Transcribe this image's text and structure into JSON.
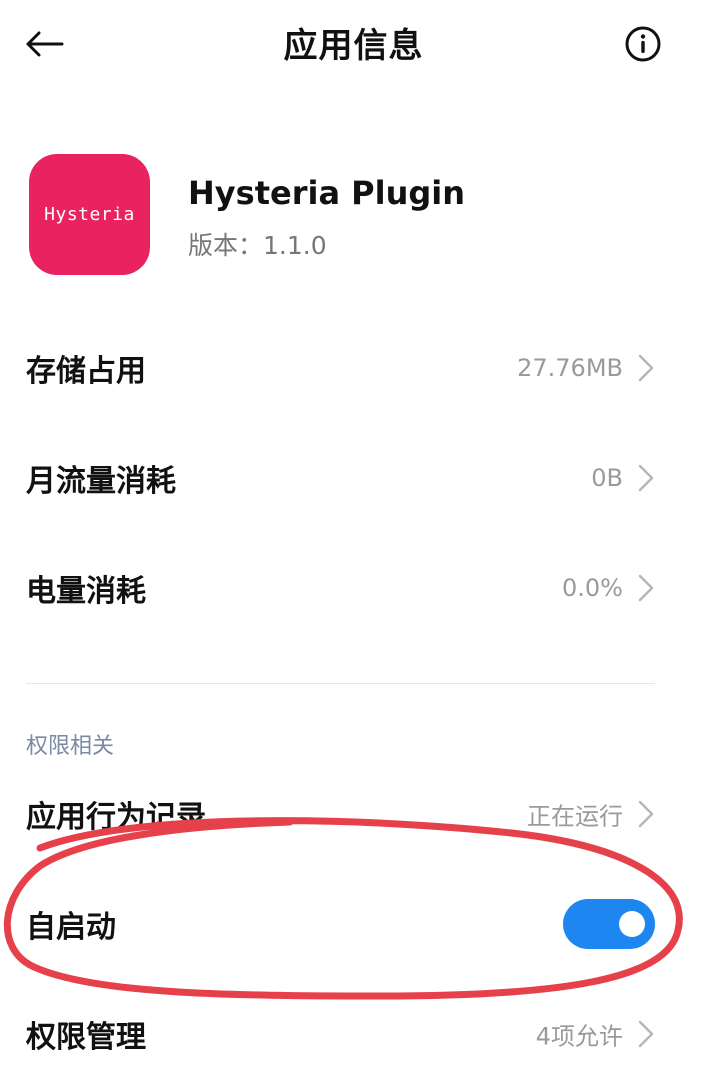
{
  "header": {
    "title": "应用信息",
    "back_icon": "arrow-left-icon",
    "info_icon": "info-icon"
  },
  "app": {
    "icon_text": "Hysteria",
    "icon_color": "#e9235f",
    "name": "Hysteria Plugin",
    "version": "版本：1.1.0"
  },
  "usage": [
    {
      "label": "存储占用",
      "value": "27.76MB"
    },
    {
      "label": "月流量消耗",
      "value": "0B"
    },
    {
      "label": "电量消耗",
      "value": "0.0%"
    }
  ],
  "permissions": {
    "section_title": "权限相关",
    "behavior_record": {
      "label": "应用行为记录",
      "value": "正在运行"
    },
    "autostart": {
      "label": "自启动",
      "enabled": true
    },
    "manage": {
      "label": "权限管理",
      "value": "4项允许"
    }
  },
  "colors": {
    "accent": "#1e86f0",
    "annotation": "#e6404a"
  }
}
